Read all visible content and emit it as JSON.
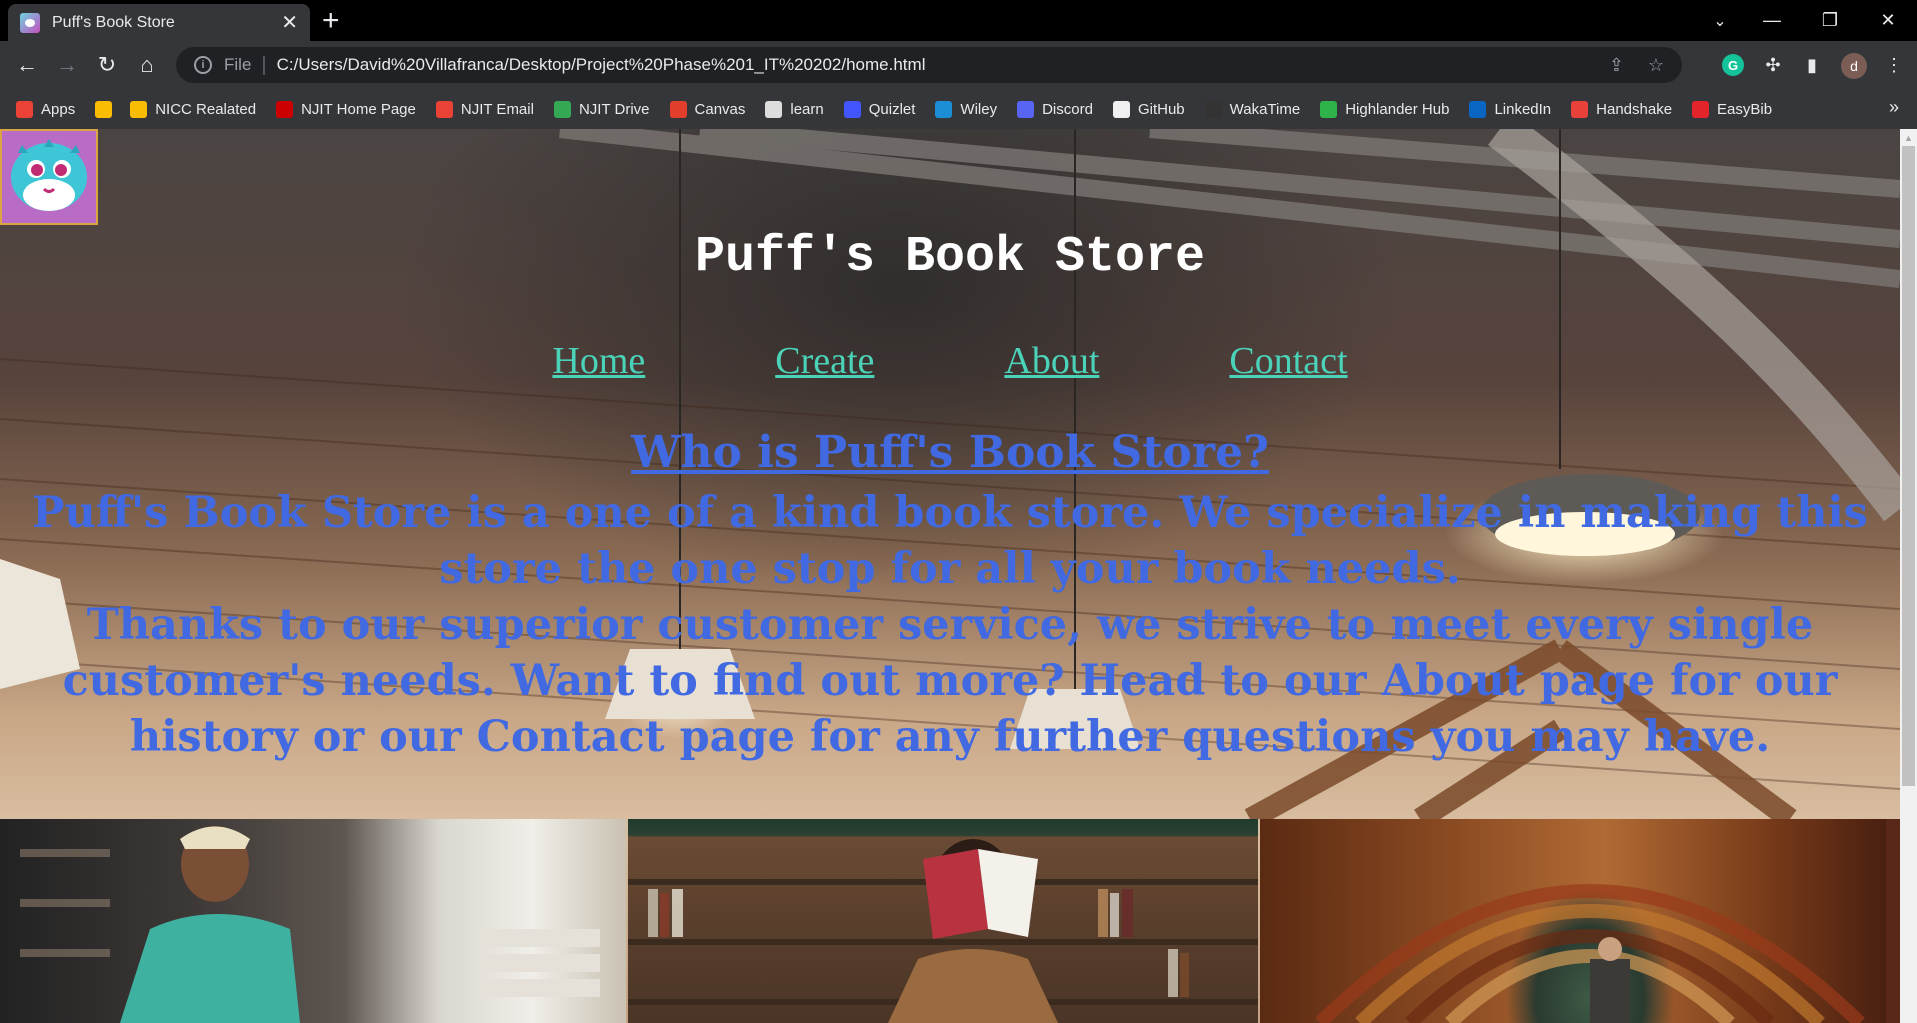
{
  "browser": {
    "tab_title": "Puff's Book Store",
    "url": "C:/Users/David%20Villafranca/Desktop/Project%20Phase%201_IT%20202/home.html",
    "scheme_label": "File",
    "profile_initial": "d",
    "bookmarks": [
      {
        "label": "Apps",
        "color": "#ea4335"
      },
      {
        "label": "",
        "color": "#fbbc04"
      },
      {
        "label": "NICC Realated",
        "color": "#fbbc04"
      },
      {
        "label": "NJIT Home Page",
        "color": "#cc0000"
      },
      {
        "label": "NJIT Email",
        "color": "#ea4335"
      },
      {
        "label": "NJIT Drive",
        "color": "#34a853"
      },
      {
        "label": "Canvas",
        "color": "#e13f2b"
      },
      {
        "label": "learn",
        "color": "#dddddd"
      },
      {
        "label": "Quizlet",
        "color": "#4255ff"
      },
      {
        "label": "Wiley",
        "color": "#1b8ed6"
      },
      {
        "label": "Discord",
        "color": "#5865f2"
      },
      {
        "label": "GitHub",
        "color": "#f0f0f0"
      },
      {
        "label": "WakaTime",
        "color": "#333333"
      },
      {
        "label": "Highlander Hub",
        "color": "#2eb34a"
      },
      {
        "label": "LinkedIn",
        "color": "#0a66c2"
      },
      {
        "label": "Handshake",
        "color": "#e8413c"
      },
      {
        "label": "EasyBib",
        "color": "#e3242b"
      }
    ]
  },
  "page": {
    "title": "Puff's Book Store",
    "nav": [
      "Home",
      "Create",
      "About",
      "Contact"
    ],
    "about_heading": "Who is Puff's Book Store?",
    "about_paragraphs": [
      "Puff's Book Store is a one of a kind book store. We specialize in making this store the one stop for all your book needs.",
      "Thanks to our superior customer service, we strive to meet every single customer's needs. Want to find out more? Head to our About page for our history or our Contact page for any further questions you may have."
    ]
  },
  "colors": {
    "nav_link": "#4ad3b9",
    "about_text": "#4169e1",
    "title_text": "#ffffff"
  }
}
